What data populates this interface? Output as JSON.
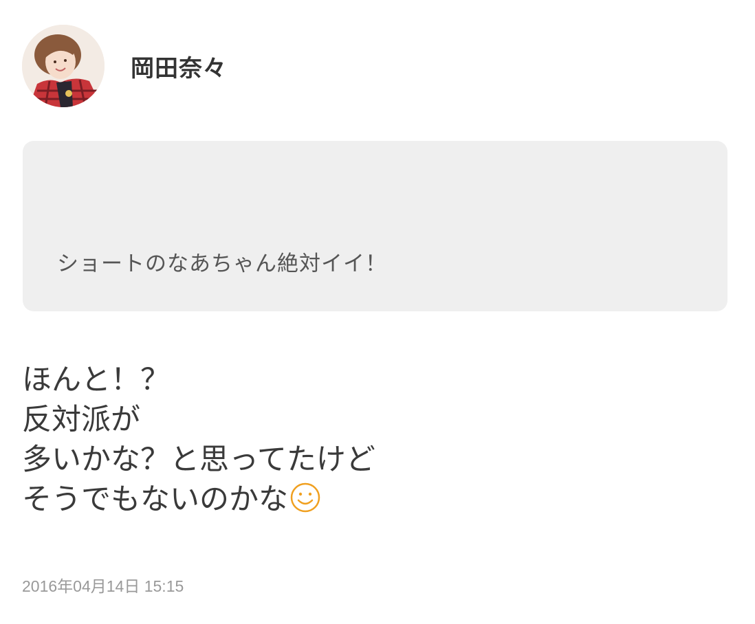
{
  "author": {
    "name": "岡田奈々"
  },
  "quote": {
    "text": "ショートのなあちゃん絶対イイ！"
  },
  "reply": {
    "lines": [
      "ほんと！？",
      "反対派が",
      "多いかな？と思ってたけど",
      "そうでもないのかな"
    ],
    "trailing_icon": "smiley-icon"
  },
  "timestamp": "2016年04月14日 15:15",
  "colors": {
    "quote_bg": "#efefef",
    "smiley": "#f0a020",
    "timestamp": "#999999"
  }
}
